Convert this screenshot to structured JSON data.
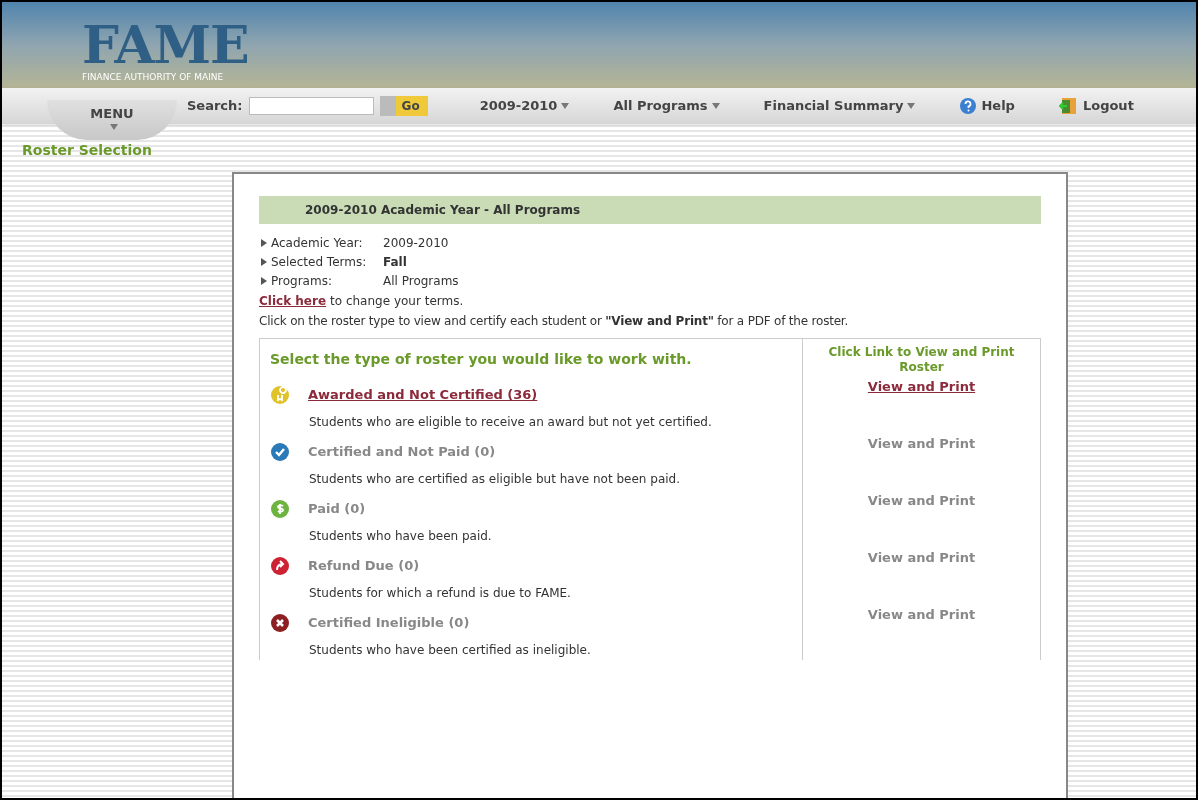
{
  "logo": {
    "wordmark": "FAME",
    "tagline": "FINANCE AUTHORITY OF MAINE"
  },
  "nav": {
    "menu": "MENU",
    "search_label": "Search:",
    "go": "Go",
    "items": [
      {
        "label": "2009-2010",
        "kind": "dropdown"
      },
      {
        "label": "All Programs",
        "kind": "dropdown"
      },
      {
        "label": "Financial Summary",
        "kind": "dropdown"
      },
      {
        "label": "Help",
        "kind": "help"
      },
      {
        "label": "Logout",
        "kind": "logout"
      }
    ]
  },
  "page_title": "Roster Selection",
  "panel": {
    "heading": "2009-2010 Academic Year - All Programs",
    "details": [
      {
        "label": "Academic Year:",
        "value": "2009-2010",
        "bold": false
      },
      {
        "label": "Selected Terms:",
        "value": "Fall",
        "bold": true
      },
      {
        "label": "Programs:",
        "value": "All Programs",
        "bold": false
      }
    ],
    "change_link": "Click here",
    "change_text": "to change your terms.",
    "instructions": "Click on the roster type to view and certify each student or **\"View and Print\"** for a PDF of the roster.",
    "roster_heading": "Select the type of roster you would like to work with.",
    "print_heading": "Click Link to View and Print Roster",
    "rosters": [
      {
        "kind": "award",
        "title": "Awarded and Not Certified (36)",
        "description": "Students who are eligible to receive an award but not yet certified.",
        "print": "View and Print",
        "disabled": false
      },
      {
        "kind": "certified",
        "title": "Certified and Not Paid (0)",
        "description": "Students who are certified as eligible but have not been paid.",
        "print": "View and Print",
        "disabled": true
      },
      {
        "kind": "paid",
        "title": "Paid (0)",
        "description": "Students who have been paid.",
        "print": "View and Print",
        "disabled": true
      },
      {
        "kind": "refund",
        "title": "Refund Due (0)",
        "description": "Students for which a refund is due to FAME.",
        "print": "View and Print",
        "disabled": true
      },
      {
        "kind": "ineligible",
        "title": "Certified Ineligible (0)",
        "description": "Students who have been certified as ineligible.",
        "print": "View and Print",
        "disabled": true
      }
    ]
  }
}
